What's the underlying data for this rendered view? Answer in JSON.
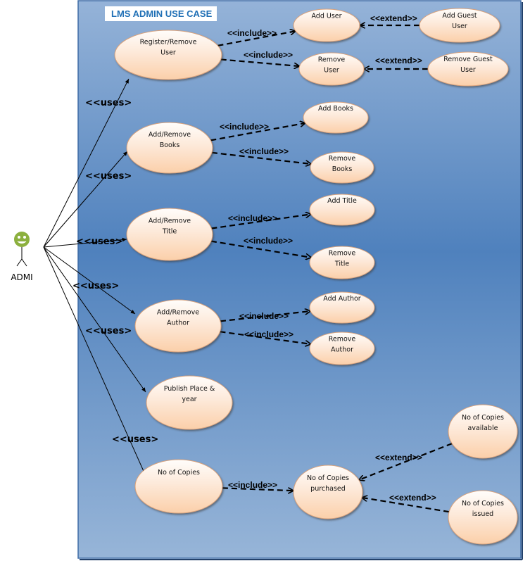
{
  "title": "LMS ADMIN USE CASE",
  "actor": {
    "label": "ADMI",
    "icon": "smiley-actor-icon",
    "head_color": "#8cb03f"
  },
  "colors": {
    "boundary_top": "#93b2d8",
    "boundary_mid": "#4f81bd",
    "boundary_bottom": "#95b3d7",
    "usecase_fill_top": "#fffaf5",
    "usecase_fill_bottom": "#fbd2b0",
    "usecase_stroke": "#d9a27c",
    "title_color": "#1f6fb5"
  },
  "use_cases": [
    {
      "id": "register_remove_user",
      "lines": [
        "Register/Remove",
        "User"
      ]
    },
    {
      "id": "add_user",
      "lines": [
        "Add User"
      ]
    },
    {
      "id": "add_guest_user",
      "lines": [
        "Add Guest",
        "User"
      ]
    },
    {
      "id": "remove_user",
      "lines": [
        "Remove",
        "User"
      ]
    },
    {
      "id": "remove_guest_user",
      "lines": [
        "Remove Guest",
        "User"
      ]
    },
    {
      "id": "add_remove_books",
      "lines": [
        "Add/Remove",
        "Books"
      ]
    },
    {
      "id": "add_books",
      "lines": [
        "Add Books"
      ]
    },
    {
      "id": "remove_books",
      "lines": [
        "Remove",
        "Books"
      ]
    },
    {
      "id": "add_remove_title",
      "lines": [
        "Add/Remove",
        "Title"
      ]
    },
    {
      "id": "add_title",
      "lines": [
        "Add Title"
      ]
    },
    {
      "id": "remove_title",
      "lines": [
        "Remove",
        "Title"
      ]
    },
    {
      "id": "add_remove_author",
      "lines": [
        "Add/Remove",
        "Author"
      ]
    },
    {
      "id": "add_author",
      "lines": [
        "Add Author"
      ]
    },
    {
      "id": "remove_author",
      "lines": [
        "Remove",
        "Author"
      ]
    },
    {
      "id": "publish_place_year",
      "lines": [
        "Publish Place &",
        "year"
      ]
    },
    {
      "id": "no_of_copies",
      "lines": [
        "No of Copies"
      ]
    },
    {
      "id": "no_of_copies_purchased",
      "lines": [
        "No of Copies",
        "purchased"
      ]
    },
    {
      "id": "no_of_copies_available",
      "lines": [
        "No of Copies",
        "available"
      ]
    },
    {
      "id": "no_of_copies_issued",
      "lines": [
        "No of Copies",
        "issued"
      ]
    }
  ],
  "uses_relations": [
    {
      "to": "register_remove_user",
      "label": "<<uses>"
    },
    {
      "to": "add_remove_books",
      "label": "<<uses>"
    },
    {
      "to": "add_remove_title",
      "label": "<<uses>"
    },
    {
      "to": "add_remove_author",
      "label": "<<uses>"
    },
    {
      "to": "publish_place_year",
      "label": "<<uses>"
    },
    {
      "to": "no_of_copies",
      "label": "<<uses>"
    }
  ],
  "relations": [
    {
      "type": "include",
      "from": "register_remove_user",
      "to": "add_user",
      "label": "<<include>>"
    },
    {
      "type": "include",
      "from": "register_remove_user",
      "to": "remove_user",
      "label": "<<include>>"
    },
    {
      "type": "extend",
      "from": "add_guest_user",
      "to": "add_user",
      "label": "<<extend>>"
    },
    {
      "type": "extend",
      "from": "remove_guest_user",
      "to": "remove_user",
      "label": "<<extend>>"
    },
    {
      "type": "include",
      "from": "add_remove_books",
      "to": "add_books",
      "label": "<<include>>"
    },
    {
      "type": "include",
      "from": "add_remove_books",
      "to": "remove_books",
      "label": "<<include>>"
    },
    {
      "type": "include",
      "from": "add_remove_title",
      "to": "add_title",
      "label": "<<include>>"
    },
    {
      "type": "include",
      "from": "add_remove_title",
      "to": "remove_title",
      "label": "<<include>>"
    },
    {
      "type": "include",
      "from": "add_remove_author",
      "to": "add_author",
      "label": "<<include>>"
    },
    {
      "type": "include",
      "from": "add_remove_author",
      "to": "remove_author",
      "label": "<<include>>"
    },
    {
      "type": "include",
      "from": "no_of_copies",
      "to": "no_of_copies_purchased",
      "label": "<<include>>"
    },
    {
      "type": "extend",
      "from": "no_of_copies_available",
      "to": "no_of_copies_purchased",
      "label": "<<extend>>"
    },
    {
      "type": "extend",
      "from": "no_of_copies_issued",
      "to": "no_of_copies_purchased",
      "label": "<<extend>>"
    }
  ]
}
